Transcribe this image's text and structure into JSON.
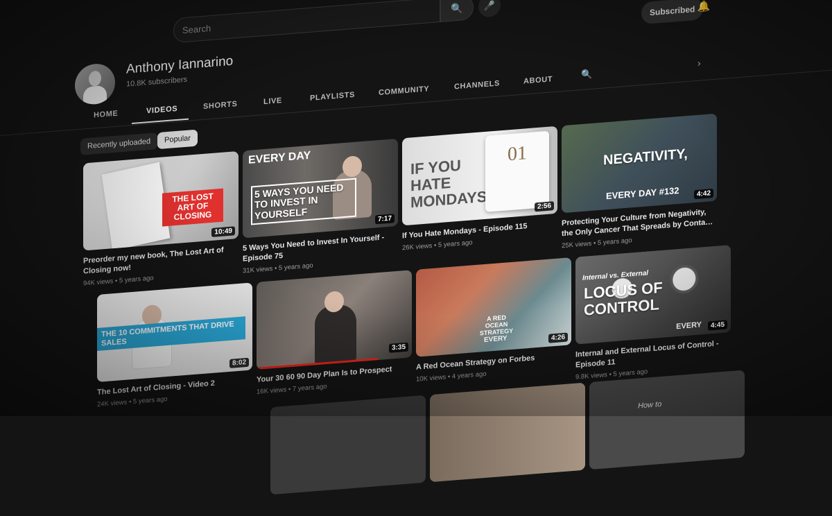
{
  "search": {
    "placeholder": "Search"
  },
  "header": {
    "subscribed_label": "Subscribed"
  },
  "channel": {
    "name": "Anthony Iannarino",
    "subscribers": "10.8K subscribers"
  },
  "tabs": [
    {
      "label": "HOME"
    },
    {
      "label": "VIDEOS"
    },
    {
      "label": "SHORTS"
    },
    {
      "label": "LIVE"
    },
    {
      "label": "PLAYLISTS"
    },
    {
      "label": "COMMUNITY"
    },
    {
      "label": "CHANNELS"
    },
    {
      "label": "ABOUT"
    }
  ],
  "chips": [
    {
      "label": "Recently uploaded"
    },
    {
      "label": "Popular"
    }
  ],
  "videos": [
    {
      "title": "Preorder my new book, The Lost Art of Closing now!",
      "duration": "10:49",
      "views": "94K views",
      "age": "5 years ago",
      "thumb_text": "THE LOST ART OF CLOSING"
    },
    {
      "title": "5 Ways You Need to Invest In Yourself - Episode 75",
      "duration": "7:17",
      "views": "31K views",
      "age": "5 years ago",
      "thumb_text": "5 WAYS YOU NEED TO INVEST IN YOURSELF",
      "thumb_kicker": "EVERY DAY"
    },
    {
      "title": "If You Hate Mondays - Episode 115",
      "duration": "2:56",
      "views": "26K views",
      "age": "5 years ago",
      "thumb_text": "IF YOU HATE MONDAYS",
      "thumb_number": "01"
    },
    {
      "title": "Protecting Your Culture from Negativity, the Only Cancer That Spreads by Contact -...",
      "duration": "4:42",
      "views": "25K views",
      "age": "5 years ago",
      "thumb_text": "NEGATIVITY,",
      "thumb_kicker": "EVERY DAY #132"
    },
    {
      "title": "The Lost Art of Closing - Video 2",
      "duration": "8:02",
      "views": "24K views",
      "age": "5 years ago",
      "thumb_text": "THE 10 COMMITMENTS THAT DRIVE SALES"
    },
    {
      "title": "Your 30 60 90 Day Plan Is to Prospect",
      "duration": "3:35",
      "views": "16K views",
      "age": "7 years ago",
      "watched_progress": 0.78
    },
    {
      "title": "A Red Ocean Strategy on Forbes",
      "duration": "4:26",
      "views": "10K views",
      "age": "4 years ago",
      "thumb_text": "A RED OCEAN STRATEGY",
      "thumb_kicker": "EVERY"
    },
    {
      "title": "Internal and External Locus of Control - Episode 11",
      "duration": "4:45",
      "views": "9.8K views",
      "age": "5 years ago",
      "thumb_text": "LOCUS OF CONTROL",
      "thumb_kicker": "Internal vs. External",
      "thumb_tag": "EVERY"
    }
  ],
  "partial_row": {
    "last_thumb_text": "How to"
  }
}
